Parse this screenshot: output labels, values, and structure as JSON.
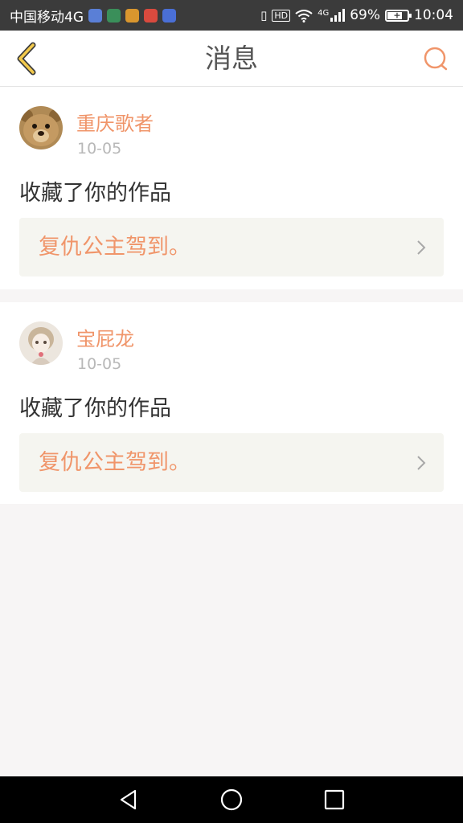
{
  "status_bar": {
    "carrier": "中国移动4G",
    "signal_label": "4G",
    "battery": "69%",
    "time": "10:04",
    "hd_label": "HD"
  },
  "header": {
    "title": "消息",
    "back_icon": "chevron-left-icon",
    "search_icon": "search-icon",
    "accent_color": "#f0956a"
  },
  "messages": [
    {
      "username": "重庆歌者",
      "date": "10-05",
      "action": "收藏了你的作品",
      "work_title": "复仇公主驾到。",
      "avatar": "teddy-bear-avatar"
    },
    {
      "username": "宝屁龙",
      "date": "10-05",
      "action": "收藏了你的作品",
      "work_title": "复仇公主驾到。",
      "avatar": "anime-girl-avatar"
    }
  ],
  "nav_bar": {
    "back_icon": "triangle-back-icon",
    "home_icon": "circle-home-icon",
    "recent_icon": "square-recent-icon"
  }
}
